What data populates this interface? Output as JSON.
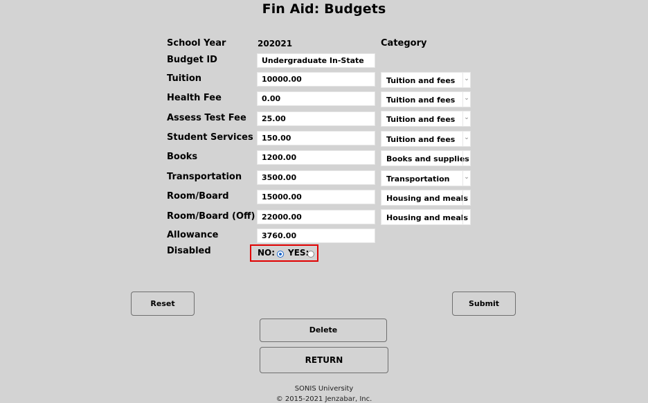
{
  "page": {
    "title": "Fin Aid: Budgets"
  },
  "form": {
    "school_year_label": "School Year",
    "school_year_value": "202021",
    "category_header": "Category",
    "budget_id_label": "Budget ID",
    "budget_id_value": "Undergraduate In-State",
    "rows": [
      {
        "label": "Tuition",
        "value": "10000.00",
        "category": "Tuition and fees"
      },
      {
        "label": "Health Fee",
        "value": "0.00",
        "category": "Tuition and fees"
      },
      {
        "label": "Assess Test Fee",
        "value": "25.00",
        "category": "Tuition and fees"
      },
      {
        "label": "Student Services",
        "value": "150.00",
        "category": "Tuition and fees"
      },
      {
        "label": "Books",
        "value": "1200.00",
        "category": "Books and supplies"
      },
      {
        "label": "Transportation",
        "value": "3500.00",
        "category": "Transportation"
      },
      {
        "label": "Room/Board",
        "value": "15000.00",
        "category": "Housing and meals"
      },
      {
        "label": "Room/Board (Off)",
        "value": "22000.00",
        "category": "Housing and meals"
      }
    ],
    "allowance_label": "Allowance",
    "allowance_value": "3760.00",
    "disabled_label": "Disabled",
    "disabled_no_label": "NO:",
    "disabled_yes_label": "YES:",
    "disabled_selected": "NO"
  },
  "buttons": {
    "reset": "Reset",
    "submit": "Submit",
    "delete": "Delete",
    "return": "RETURN"
  },
  "footer": {
    "org": "SONIS University",
    "copyright": "© 2015-2021 Jenzabar, Inc."
  },
  "icons": {
    "select_arrow": "chevron-down-icon"
  },
  "colors": {
    "background": "#d3d3d3",
    "highlight_border": "#e00000",
    "radio_accent": "#1a66c8"
  }
}
